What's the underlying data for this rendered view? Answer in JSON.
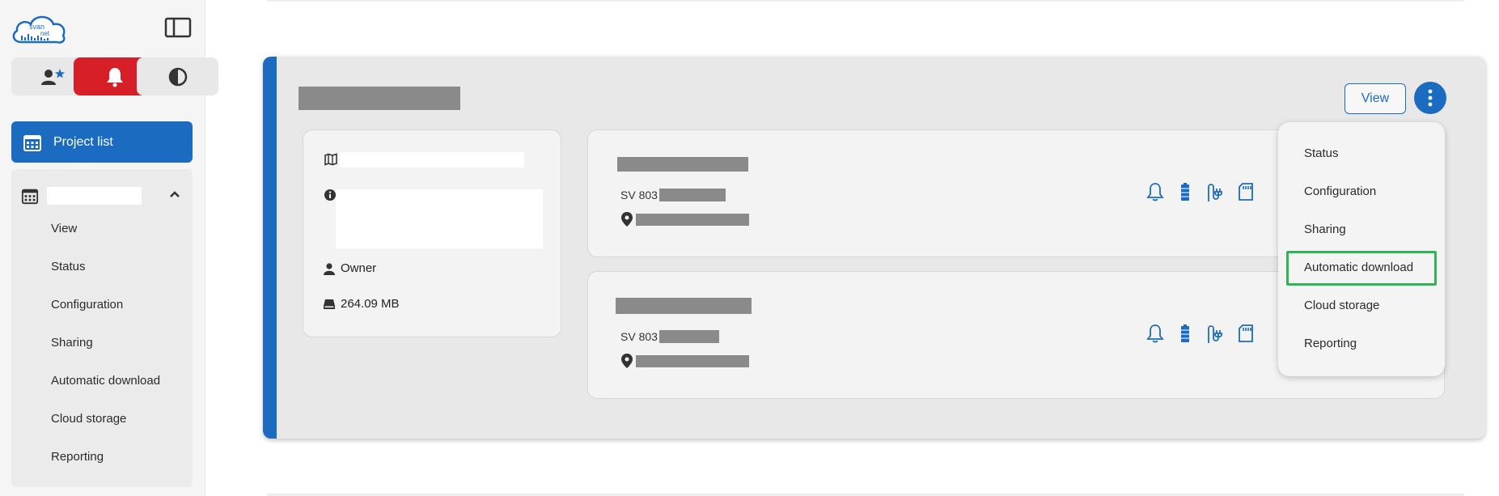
{
  "brand": {
    "logo_text_1": "svan",
    "logo_text_2": "net"
  },
  "sidebar": {
    "quick_buttons": [
      {
        "icon": "user-star-icon"
      },
      {
        "icon": "bell-icon",
        "color": "#d61f26"
      },
      {
        "icon": "contrast-icon"
      }
    ],
    "project_list_label": "Project list",
    "project_name": "",
    "project_items": [
      {
        "label": "View"
      },
      {
        "label": "Status"
      },
      {
        "label": "Configuration"
      },
      {
        "label": "Sharing"
      },
      {
        "label": "Automatic download"
      },
      {
        "label": "Cloud storage"
      },
      {
        "label": "Reporting"
      }
    ]
  },
  "project_card": {
    "accent_color": "#1b6cc0",
    "title": "",
    "view_label": "View",
    "owner_label": "Owner",
    "size_label": "264.09 MB",
    "devices": [
      {
        "model_prefix": "SV 803",
        "serial": "",
        "location": "",
        "status_icons": [
          "bell-icon",
          "battery-icon",
          "power-plug-icon",
          "sd-card-icon"
        ]
      },
      {
        "model_prefix": "SV 803",
        "serial": "",
        "location": "",
        "status_icons": [
          "bell-icon",
          "battery-icon",
          "power-plug-icon",
          "sd-card-icon"
        ]
      }
    ]
  },
  "menu": {
    "items": [
      {
        "label": "Status"
      },
      {
        "label": "Configuration"
      },
      {
        "label": "Sharing"
      },
      {
        "label": "Automatic download",
        "highlighted": true
      },
      {
        "label": "Cloud storage"
      },
      {
        "label": "Reporting"
      }
    ],
    "highlight_color": "#2fb552"
  }
}
